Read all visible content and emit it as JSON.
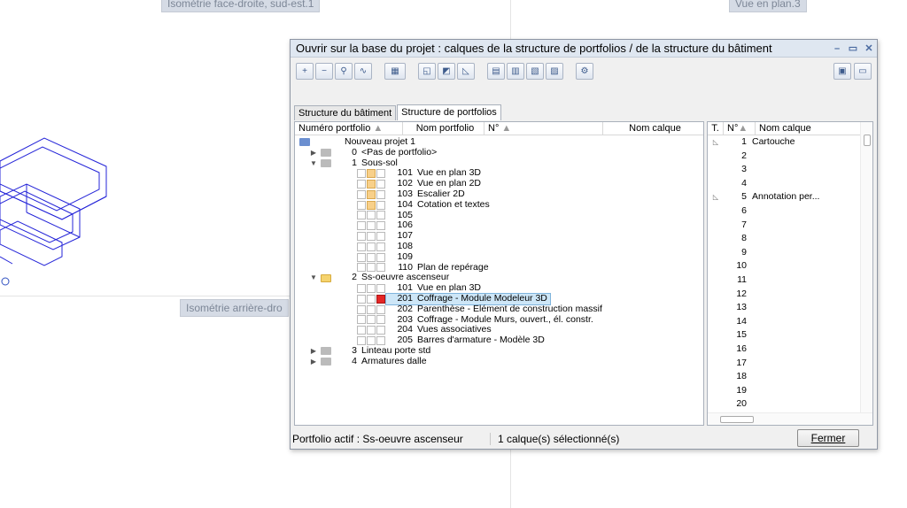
{
  "background": {
    "view_top_left": "Isométrie face-droite, sud-est.1",
    "view_top_right": "Vue en plan.3",
    "view_mid_left": "Isométrie arrière-dro"
  },
  "dialog": {
    "title": "Ouvrir sur la base du projet : calques de la structure de portfolios / de la structure du bâtiment",
    "tabs": [
      "Structure du bâtiment",
      "Structure de portfolios"
    ],
    "left_headers": [
      "Numéro portfolio",
      "Nom portfolio",
      "N°",
      "Nom calque"
    ],
    "right_headers": [
      "T.",
      "N°",
      "Nom calque"
    ],
    "tree": [
      {
        "level": 0,
        "label": "Nouveau projet 1"
      },
      {
        "level": 1,
        "num": "0",
        "label": "<Pas de portfolio>",
        "arrow": "▶"
      },
      {
        "level": 1,
        "num": "1",
        "label": "Sous-sol",
        "arrow": "▼"
      },
      {
        "level": 2,
        "num": "101",
        "label": "Vue en plan 3D",
        "color": "y"
      },
      {
        "level": 2,
        "num": "102",
        "label": "Vue en plan 2D",
        "color": "y"
      },
      {
        "level": 2,
        "num": "103",
        "label": "Escalier 2D",
        "color": "y"
      },
      {
        "level": 2,
        "num": "104",
        "label": "Cotation et textes",
        "color": "y"
      },
      {
        "level": 2,
        "num": "105",
        "label": ""
      },
      {
        "level": 2,
        "num": "106",
        "label": ""
      },
      {
        "level": 2,
        "num": "107",
        "label": ""
      },
      {
        "level": 2,
        "num": "108",
        "label": ""
      },
      {
        "level": 2,
        "num": "109",
        "label": ""
      },
      {
        "level": 2,
        "num": "110",
        "label": "Plan de repérage"
      },
      {
        "level": 1,
        "num": "2",
        "label": "Ss-oeuvre ascenseur",
        "arrow": "▼",
        "open": true
      },
      {
        "level": 2,
        "num": "101",
        "label": "Vue en plan 3D"
      },
      {
        "level": 2,
        "num": "201",
        "label": "Coffrage - Module Modeleur 3D",
        "color": "r",
        "selected": true
      },
      {
        "level": 2,
        "num": "202",
        "label": "Parenthèse - Elément de construction massif"
      },
      {
        "level": 2,
        "num": "203",
        "label": "Coffrage - Module Murs, ouvert., él. constr."
      },
      {
        "level": 2,
        "num": "204",
        "label": "Vues associatives"
      },
      {
        "level": 2,
        "num": "205",
        "label": "Barres d'armature - Modèle 3D"
      },
      {
        "level": 1,
        "num": "3",
        "label": "Linteau porte std",
        "arrow": "▶"
      },
      {
        "level": 1,
        "num": "4",
        "label": "Armatures dalle",
        "arrow": "▶"
      }
    ],
    "right_rows": [
      {
        "num": "1",
        "name": "Cartouche",
        "t": "◺"
      },
      {
        "num": "2",
        "name": ""
      },
      {
        "num": "3",
        "name": ""
      },
      {
        "num": "4",
        "name": ""
      },
      {
        "num": "5",
        "name": "Annotation per...",
        "t": "◺"
      },
      {
        "num": "6",
        "name": ""
      },
      {
        "num": "7",
        "name": ""
      },
      {
        "num": "8",
        "name": ""
      },
      {
        "num": "9",
        "name": ""
      },
      {
        "num": "10",
        "name": ""
      },
      {
        "num": "11",
        "name": ""
      },
      {
        "num": "12",
        "name": ""
      },
      {
        "num": "13",
        "name": ""
      },
      {
        "num": "14",
        "name": ""
      },
      {
        "num": "15",
        "name": ""
      },
      {
        "num": "16",
        "name": ""
      },
      {
        "num": "17",
        "name": ""
      },
      {
        "num": "18",
        "name": ""
      },
      {
        "num": "19",
        "name": ""
      },
      {
        "num": "20",
        "name": ""
      }
    ],
    "status_portfolio": "Portfolio actif : Ss-oeuvre ascenseur",
    "status_selection": "1 calque(s) sélectionné(s)",
    "close_label": "Fermer"
  }
}
